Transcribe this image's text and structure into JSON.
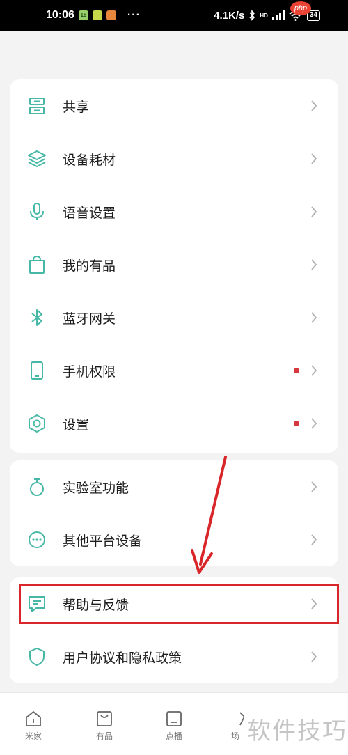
{
  "status_bar": {
    "time": "10:06",
    "badge_1": "16",
    "dots": "···",
    "net_speed": "4.1K/s",
    "signal_tag": "HD",
    "battery": "34"
  },
  "watermark_php": "php",
  "colors": {
    "icon_teal": "#47b8a6",
    "red_dot": "#d6373a",
    "highlight": "#d8262a",
    "arrow": "#d8262a"
  },
  "menu": {
    "share": "共享",
    "consumables": "设备耗材",
    "voice": "语音设置",
    "youpin": "我的有品",
    "bluetooth": "蓝牙网关",
    "permissions": "手机权限",
    "settings": "设置",
    "labs": "实验室功能",
    "other_platforms": "其他平台设备",
    "help": "帮助与反馈",
    "privacy": "用户协议和隐私政策"
  },
  "bottom_nav": {
    "home": "米家",
    "youpin": "有品",
    "broadcast": "点播",
    "fourth": "场"
  },
  "watermark_text": "软件技巧"
}
